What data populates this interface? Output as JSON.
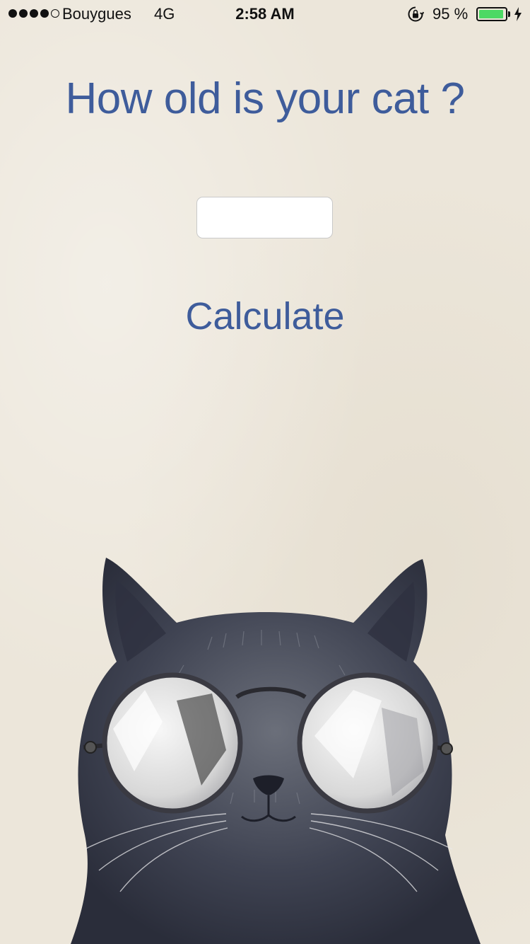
{
  "status_bar": {
    "signal_bars": 4,
    "signal_total": 5,
    "carrier": "Bouygues",
    "network": "4G",
    "time": "2:58 AM",
    "orientation_lock_icon": "orientation-lock-icon",
    "battery_percent": "95 %",
    "battery_level": 0.95,
    "battery_color": "#4cd964",
    "charging_icon": "bolt-icon"
  },
  "main": {
    "title": "How old is your cat ?",
    "age_input": {
      "value": "",
      "placeholder": ""
    },
    "calculate_label": "Calculate",
    "accent_color": "#3e5c9b",
    "illustration": "cat-with-round-glasses"
  }
}
